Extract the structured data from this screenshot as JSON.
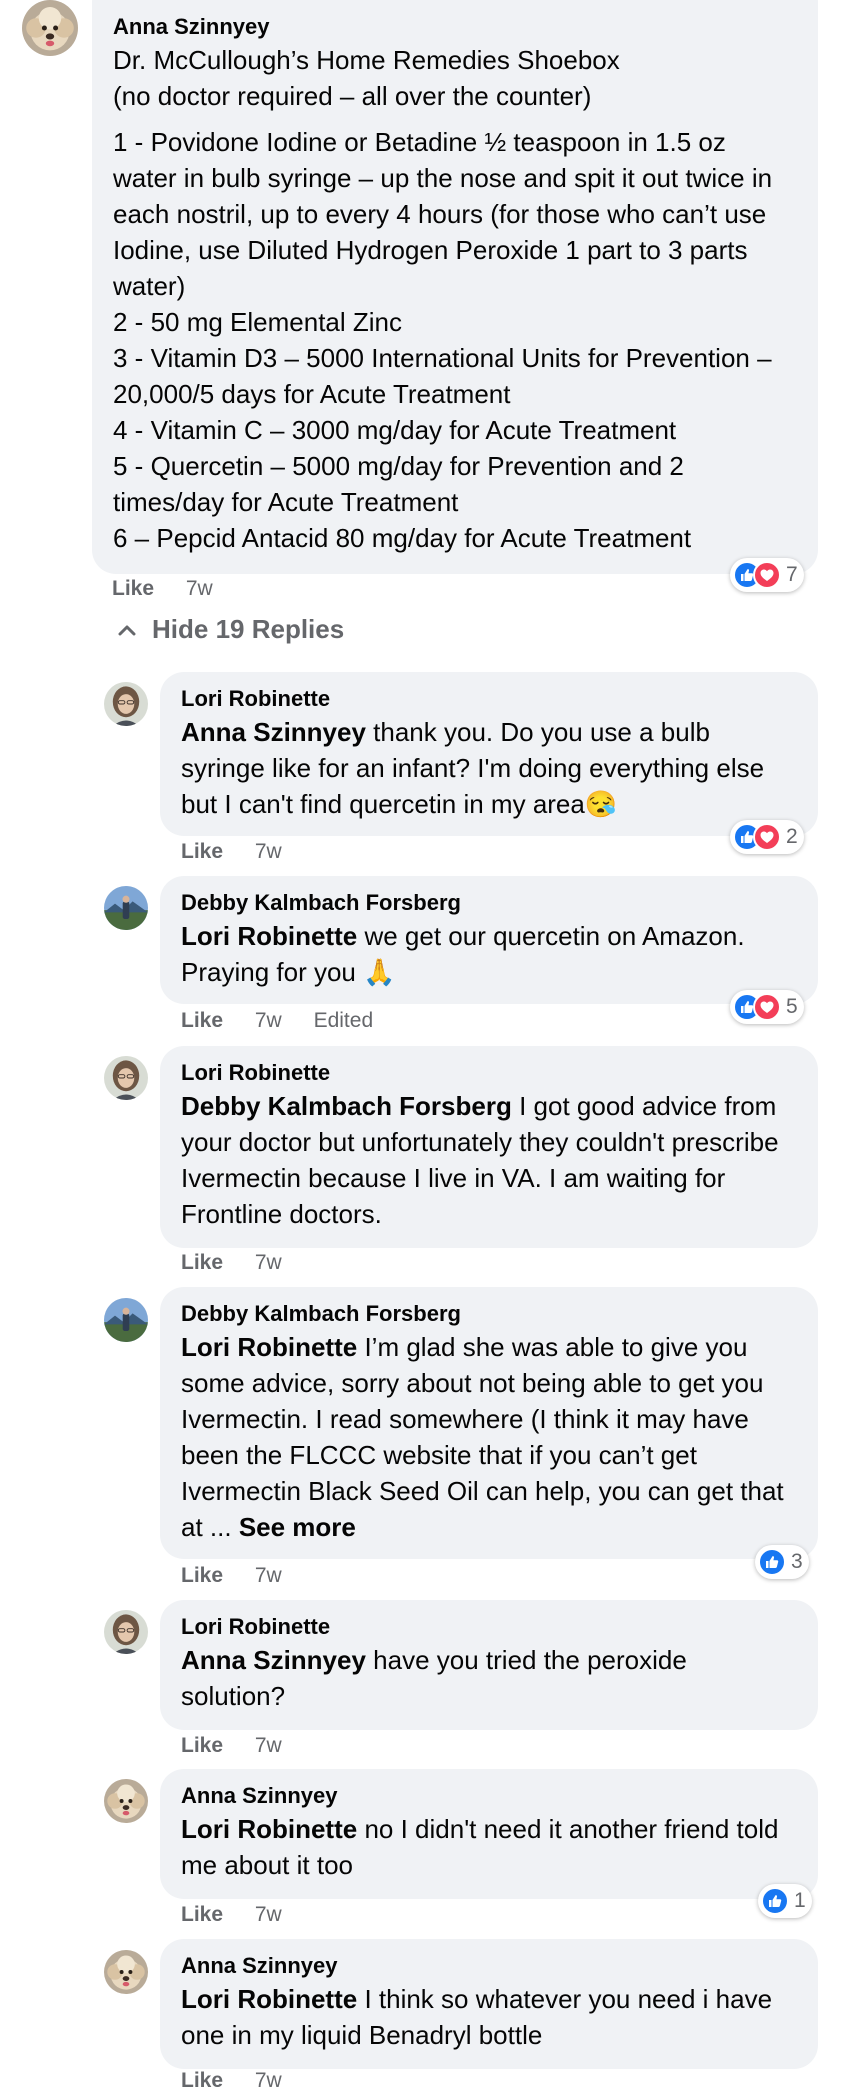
{
  "colors": {
    "bubble": "#f0f2f5",
    "like_blue": "#1877f2",
    "love_red": "#f33e58",
    "meta_gray": "#65676b"
  },
  "main_comment": {
    "author": "Anna Szinnyey",
    "lines": [
      "Dr. McCullough’s Home Remedies Shoebox",
      "(no doctor required – all over the counter)",
      "1 - Povidone Iodine or Betadine ½ teaspoon in 1.5 oz water in bulb syringe – up the nose and spit it out twice in each nostril, up to every 4 hours (for those who can’t use Iodine, use Diluted Hydrogen Peroxide 1 part to 3 parts water)",
      "2 - 50 mg Elemental Zinc",
      "3 - Vitamin D3 – 5000 International Units for Prevention – 20,000/5 days for Acute Treatment",
      "4 - Vitamin C – 3000 mg/day for Acute Treatment",
      "5 - Quercetin – 5000 mg/day for Prevention and 2 times/day for Acute Treatment",
      "6 – Pepcid Antacid 80 mg/day for Acute Treatment"
    ],
    "like_label": "Like",
    "time": "7w",
    "reactions": {
      "icons": [
        "like-icon",
        "love-icon"
      ],
      "count": "7"
    }
  },
  "hide_replies_label": "Hide 19 Replies",
  "replies": [
    {
      "author": "Lori Robinette",
      "mention": "Anna Szinnyey",
      "text": " thank you. Do you use a bulb syringe like for an infant? I'm doing everything else but I can't find quercetin in my area",
      "emoji": "😪",
      "like_label": "Like",
      "time": "7w",
      "reaction_count": "2"
    },
    {
      "author": "Debby Kalmbach Forsberg",
      "mention": "Lori Robinette",
      "text": " we get our quercetin on Amazon. Praying for you",
      "emoji": "🙏",
      "like_label": "Like",
      "time": "7w",
      "edited": "Edited",
      "reaction_count": "5"
    },
    {
      "author": "Lori Robinette",
      "mention": "Debby Kalmbach Forsberg",
      "text": " I got good advice from your doctor but unfortunately they couldn't prescribe Ivermectin because I live in VA. I am waiting for Frontline doctors.",
      "like_label": "Like",
      "time": "7w"
    },
    {
      "author": "Debby Kalmbach Forsberg",
      "mention": "Lori Robinette",
      "text": " I’m glad she was able to give you some advice, sorry about not being able to get you Ivermectin. I read somewhere (I think it may have been the FLCCC website that if you can’t get Ivermectin Black Seed Oil can help, you can get that at ... ",
      "see_more": "See more",
      "like_label": "Like",
      "time": "7w",
      "reaction_count": "3"
    },
    {
      "author": "Lori Robinette",
      "mention": "Anna Szinnyey",
      "text": " have you tried the peroxide solution?",
      "like_label": "Like",
      "time": "7w"
    },
    {
      "author": "Anna Szinnyey",
      "mention": "Lori Robinette",
      "text": " no I didn't need it another friend told me about it too",
      "like_label": "Like",
      "time": "7w",
      "reaction_count": "1"
    },
    {
      "author": "Anna Szinnyey",
      "mention": "Lori Robinette",
      "text": " I think so whatever you need i have one in my liquid Benadryl bottle",
      "like_label": "Like",
      "time": "7w"
    }
  ]
}
